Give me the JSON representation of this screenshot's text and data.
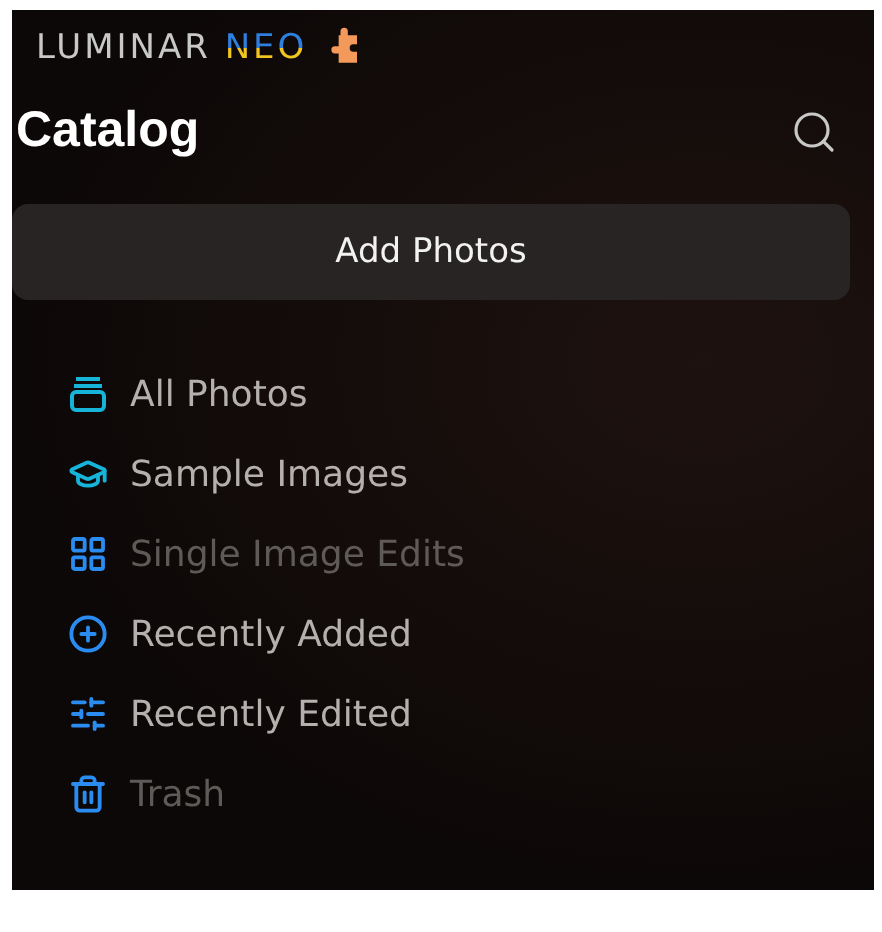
{
  "logo": {
    "word": "LUMINAR",
    "accent": "NEO"
  },
  "header": {
    "title": "Catalog"
  },
  "add_button": {
    "label": "Add Photos"
  },
  "items": [
    {
      "kind": "stack",
      "label": "All Photos",
      "disabled": false
    },
    {
      "kind": "cap",
      "label": "Sample Images",
      "disabled": false
    },
    {
      "kind": "grid",
      "label": "Single Image Edits",
      "disabled": true
    },
    {
      "kind": "plus",
      "label": "Recently Added",
      "disabled": false
    },
    {
      "kind": "sliders",
      "label": "Recently Edited",
      "disabled": false
    },
    {
      "kind": "trash",
      "label": "Trash",
      "disabled": true
    }
  ]
}
